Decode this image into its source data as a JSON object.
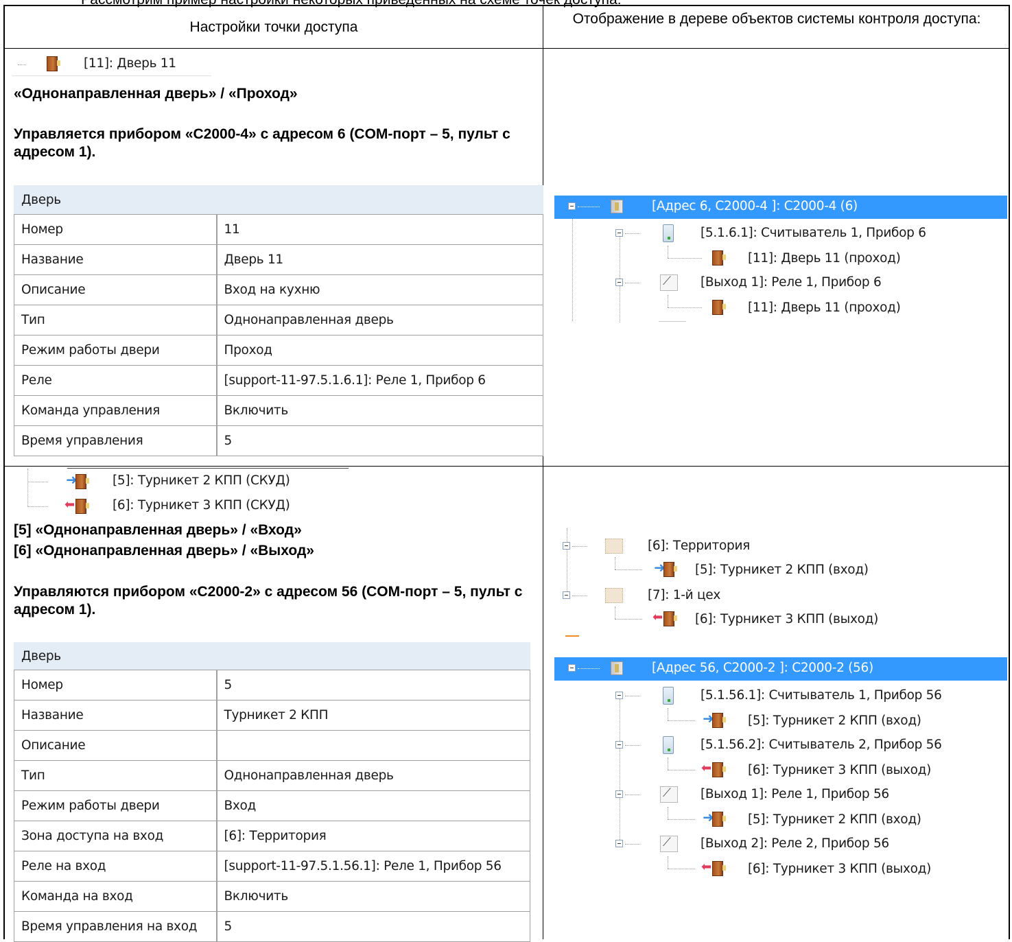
{
  "top_line": "Рассмотрим пример настройки некоторых приведенных на схеме точек доступа:",
  "headers": {
    "left": "Настройки точки доступа",
    "right": "Отображение в дереве объектов системы контроля доступа:"
  },
  "section1": {
    "tree_item": "[11]: Дверь 11",
    "mode_line": "«Однонаправленная дверь» / «Проход»",
    "control_text": "Управляется прибором «С2000-4» с адресом 6 (COM-порт – 5, пульт с адресом 1).",
    "table": {
      "category": "Дверь",
      "rows": [
        {
          "name": "Номер",
          "value": "11"
        },
        {
          "name": "Название",
          "value": "Дверь 11"
        },
        {
          "name": "Описание",
          "value": "Вход на кухню"
        },
        {
          "name": "Тип",
          "value": "Однонаправленная дверь"
        },
        {
          "name": "Режим работы двери",
          "value": "Проход"
        },
        {
          "name": "Реле",
          "value": "[support-11-97.5.1.6.1]: Реле 1, Прибор 6"
        },
        {
          "name": "Команда управления",
          "value": "Включить"
        },
        {
          "name": "Время управления",
          "value": "5"
        }
      ]
    },
    "tree": {
      "root": "[Адрес 6, С2000-4 ]: С2000-4 (6)",
      "reader": "[5.1.6.1]: Считыватель 1, Прибор 6",
      "reader_child": "[11]: Дверь 11 (проход)",
      "relay": "[Выход 1]: Реле 1, Прибор 6",
      "relay_child": "[11]: Дверь 11 (проход)"
    }
  },
  "section2": {
    "tree_item_5": "[5]: Турникет 2 КПП (СКУД)",
    "tree_item_6": "[6]: Турникет 3 КПП (СКУД)",
    "mode_line_5": "[5] «Однонаправленная дверь» / «Вход»",
    "mode_line_6": "[6] «Однонаправленная дверь» / «Выход»",
    "control_text": "Управляются прибором «С2000-2» с адресом 56 (COM-порт – 5, пульт с адресом 1).",
    "table": {
      "category": "Дверь",
      "rows": [
        {
          "name": "Номер",
          "value": "5"
        },
        {
          "name": "Название",
          "value": "Турникет 2 КПП"
        },
        {
          "name": "Описание",
          "value": ""
        },
        {
          "name": "Тип",
          "value": "Однонаправленная дверь"
        },
        {
          "name": "Режим работы двери",
          "value": "Вход"
        },
        {
          "name": "Зона доступа на вход",
          "value": "[6]: Территория"
        },
        {
          "name": "Реле на вход",
          "value": "[support-11-97.5.1.56.1]: Реле 1, Прибор 56"
        },
        {
          "name": "Команда на вход",
          "value": "Включить"
        },
        {
          "name": "Время управления на вход",
          "value": "5"
        }
      ]
    },
    "zones_tree": {
      "zone1": "[6]: Территория",
      "zone1_child": "[5]: Турникет 2 КПП (вход)",
      "zone2": "[7]: 1-й цех",
      "zone2_child": "[6]: Турникет 3 КПП (выход)"
    },
    "tree": {
      "root": "[Адрес 56, С2000-2 ]: С2000-2 (56)",
      "reader1": "[5.1.56.1]: Считыватель 1, Прибор 56",
      "reader1_child": "[5]: Турникет 2 КПП (вход)",
      "reader2": "[5.1.56.2]: Считыватель 2, Прибор 56",
      "reader2_child": "[6]: Турникет 3 КПП (выход)",
      "relay1": "[Выход 1]: Реле 1, Прибор 56",
      "relay1_child": "[5]: Турникет 2 КПП (вход)",
      "relay2": "[Выход 2]: Реле 2, Прибор 56",
      "relay2_child": "[6]: Турникет 3 КПП (выход)"
    }
  }
}
